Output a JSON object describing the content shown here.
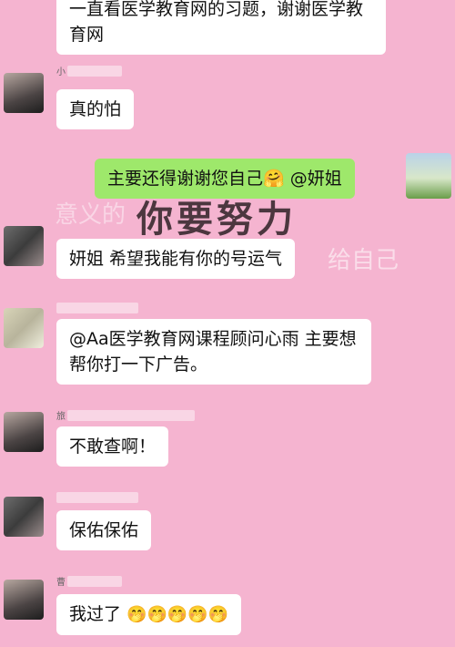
{
  "messages": {
    "m0": "一直看医学教育网的习题，谢谢医学教育网",
    "m1": "真的怕",
    "m2": "主要还得谢谢您自己🤗 @妍姐",
    "m3": "妍姐 希望我能有你的号运气",
    "m4": "@Aa医学教育网课程顾问心雨 主要想帮你打一下广告。",
    "m5": "不敢查啊！",
    "m6": "保佑保佑",
    "m7_text": "我过了",
    "m7_emoji": "🤭🤭🤭🤭🤭"
  },
  "background": {
    "main_text": "你要努力",
    "faint_left": "意义的",
    "faint_right": "给自己"
  },
  "nicknames": {
    "n1": "小",
    "n4": "旅",
    "n6": "曹"
  }
}
